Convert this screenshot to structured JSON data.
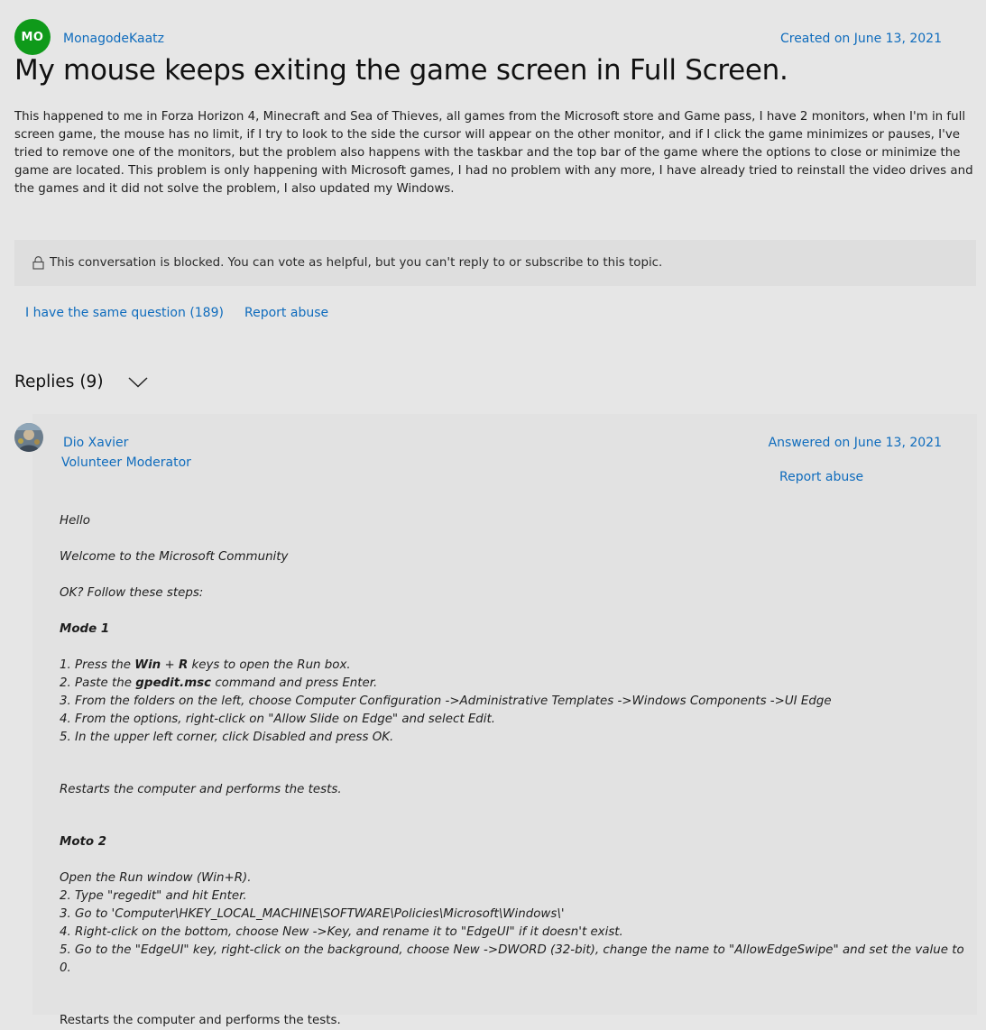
{
  "question": {
    "author_initials": "MO",
    "author_name": "MonagodeKaatz",
    "created": "Created on June 13, 2021",
    "title": "My mouse keeps exiting the game screen in Full Screen.",
    "body": "This happened to me in Forza Horizon 4, Minecraft and Sea of Thieves, all games from the Microsoft store and Game pass, I have 2 monitors, when I'm in full screen game, the mouse has no limit, if I try to look to the side the cursor will appear on the other monitor, and if I click the game minimizes or pauses, I've tried to remove one of the monitors, but the problem also happens with the taskbar and the top bar of the game where the options to close or minimize the game are located. This problem is only happening with Microsoft games, I had no problem with any more, I have already tried to reinstall the video drives and the games and it did not solve the problem, I also updated my Windows."
  },
  "blocked_notice": "This conversation is blocked. You can vote as helpful, but you can't reply to or subscribe to this topic.",
  "actions": {
    "same_question": "I have the same question (189)",
    "report_abuse": "Report abuse"
  },
  "replies": {
    "header": "Replies (9)"
  },
  "reply": {
    "author": "Dio Xavier",
    "role": "Volunteer Moderator",
    "answered": "Answered on June 13, 2021",
    "report_abuse": "Report abuse",
    "hello": "Hello",
    "welcome": "Welcome to the Microsoft Community",
    "ok": "OK? Follow these steps:",
    "mode1_title": "Mode 1",
    "m1_s1_pre": "1. Press the ",
    "m1_s1_win": "Win",
    "m1_s1_plus": " + ",
    "m1_s1_r": "R",
    "m1_s1_post": " keys to open the Run box.",
    "m1_s2_pre": "2. Paste the ",
    "m1_s2_cmd": "gpedit.msc",
    "m1_s2_post": " command and press Enter.",
    "m1_s3": "3. From the folders on the left, choose Computer Configuration ->Administrative Templates ->Windows Components ->UI Edge",
    "m1_s4": "4. From the options, right-click on \"Allow Slide on Edge\" and select Edit.",
    "m1_s5": "5. In the upper left corner, click Disabled and press OK.",
    "restart1": "Restarts the computer and performs the tests.",
    "mode2_title": "Moto 2",
    "m2_s1": "Open the Run window (Win+R).",
    "m2_s2": "2. Type \"regedit\" and hit Enter.",
    "m2_s3": "3. Go to 'Computer\\HKEY_LOCAL_MACHINE\\SOFTWARE\\Policies\\Microsoft\\Windows\\'",
    "m2_s4": "4. Right-click on the bottom, choose New ->Key, and rename it to \"EdgeUI\" if it doesn't exist.",
    "m2_s5": "5. Go to the \"EdgeUI\" key, right-click on the background, choose New ->DWORD (32-bit), change the name to \"AllowEdgeSwipe\" and set the value to 0.",
    "restart2": "Restarts the computer and performs the tests."
  },
  "colors": {
    "background": "#e6e6e6",
    "link": "#0f6cbd",
    "avatar_green": "#0f9a1a"
  }
}
